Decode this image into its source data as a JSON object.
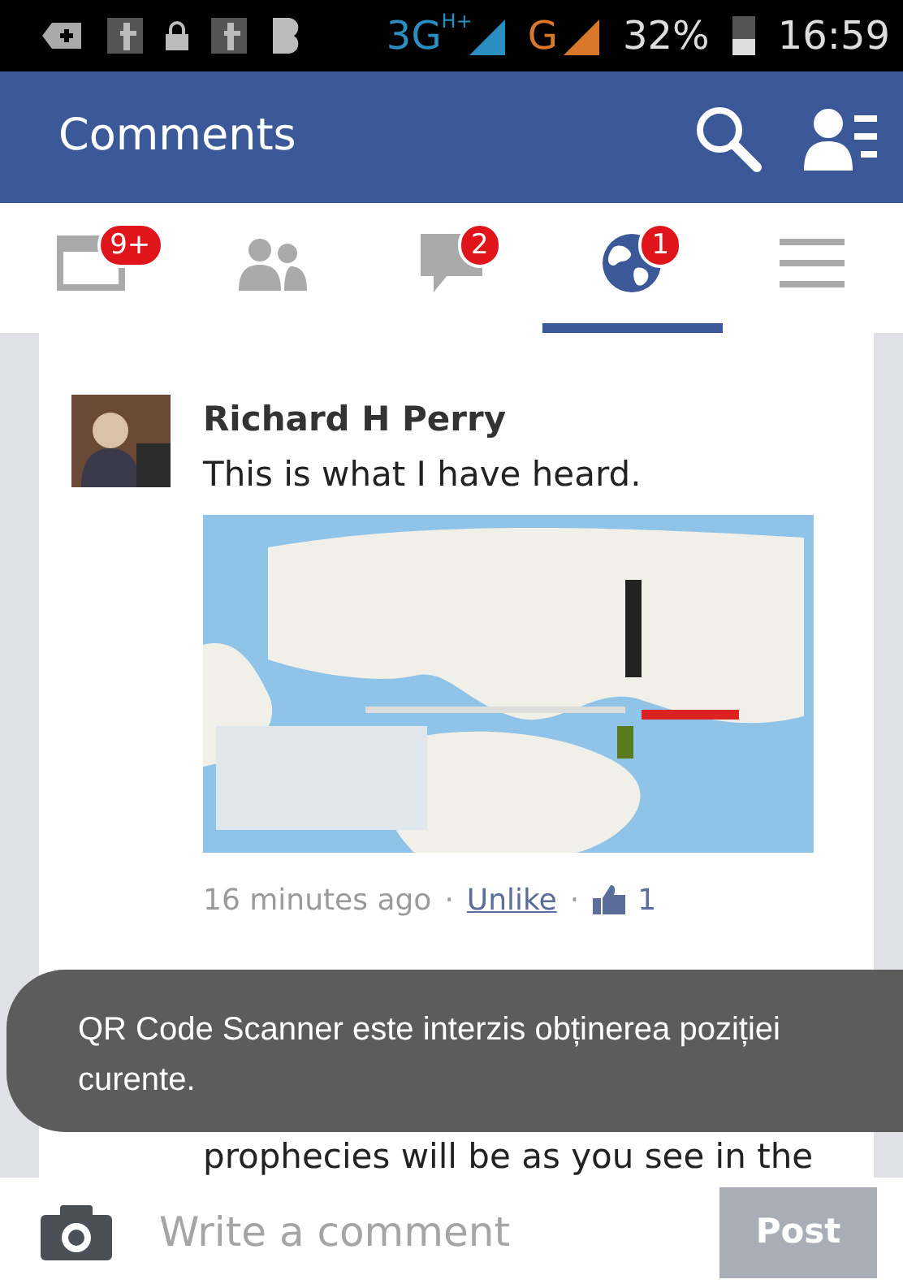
{
  "status_bar": {
    "network_type": "3G",
    "network_badge": "H+",
    "second_network": "G",
    "battery": "32%",
    "time": "16:59"
  },
  "app_bar": {
    "title": "Comments"
  },
  "tabs": [
    {
      "kind": "feed",
      "badge": "9+",
      "selected": false
    },
    {
      "kind": "friends",
      "selected": false
    },
    {
      "kind": "messages",
      "badge": "2",
      "selected": false
    },
    {
      "kind": "notifications",
      "badge": "1",
      "selected": true
    },
    {
      "kind": "menu",
      "selected": false
    }
  ],
  "comments": [
    {
      "author": "Richard H Perry",
      "text": "This is what I have heard.",
      "time": "16 minutes ago",
      "separator": "·",
      "action": "Unlike",
      "separator_2": "·",
      "likes": "1"
    },
    {
      "text": "prophecies will be as you see in the"
    }
  ],
  "toast": "QR Code Scanner este interzis obținerea poziției curente.",
  "composer": {
    "placeholder": "Write a comment",
    "button": "Post",
    "disabled": true
  }
}
